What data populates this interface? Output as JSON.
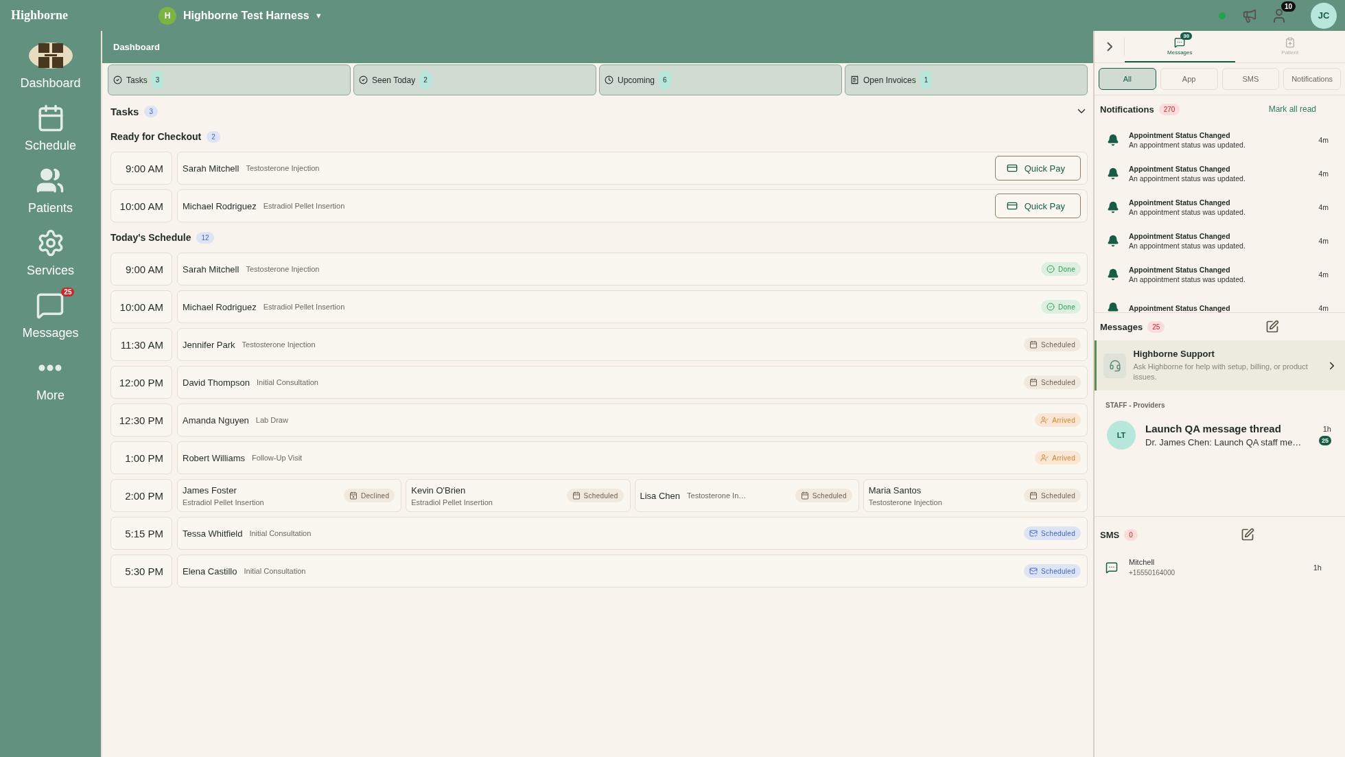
{
  "topbar": {
    "brand": "Highborne",
    "org_initial": "H",
    "org_name": "Highborne Test Harness",
    "caret": "▾",
    "people_badge": "10",
    "user_initials": "JC"
  },
  "sidebar": {
    "items": [
      {
        "label": "Dashboard"
      },
      {
        "label": "Schedule"
      },
      {
        "label": "Patients"
      },
      {
        "label": "Services"
      },
      {
        "label": "Messages",
        "badge": "25"
      },
      {
        "label": "More"
      }
    ]
  },
  "page_title": "Dashboard",
  "summary_tabs": [
    {
      "label": "Tasks",
      "count": "3"
    },
    {
      "label": "Seen Today",
      "count": "2"
    },
    {
      "label": "Upcoming",
      "count": "6"
    },
    {
      "label": "Open Invoices",
      "count": "1"
    }
  ],
  "tasks": {
    "title": "Tasks",
    "count": "3",
    "expanded": true,
    "checkout": {
      "title": "Ready for Checkout",
      "count": "2",
      "rows": [
        {
          "time": "9:00 AM",
          "name": "Sarah Mitchell",
          "service": "Testosterone Injection",
          "action": "Quick Pay"
        },
        {
          "time": "10:00 AM",
          "name": "Michael Rodriguez",
          "service": "Estradiol Pellet Insertion",
          "action": "Quick Pay"
        }
      ]
    },
    "schedule": {
      "title": "Today's Schedule",
      "count": "12",
      "rows": [
        {
          "time": "9:00 AM",
          "appointments": [
            {
              "name": "Sarah Mitchell",
              "service": "Testosterone Injection",
              "status": {
                "kind": "done",
                "label": "Done"
              }
            }
          ]
        },
        {
          "time": "10:00 AM",
          "appointments": [
            {
              "name": "Michael Rodriguez",
              "service": "Estradiol Pellet Insertion",
              "status": {
                "kind": "done",
                "label": "Done"
              }
            }
          ]
        },
        {
          "time": "11:30 AM",
          "appointments": [
            {
              "name": "Jennifer Park",
              "service": "Testosterone Injection",
              "status": {
                "kind": "scheduled",
                "label": "Scheduled"
              }
            }
          ]
        },
        {
          "time": "12:00 PM",
          "appointments": [
            {
              "name": "David Thompson",
              "service": "Initial Consultation",
              "status": {
                "kind": "scheduled",
                "label": "Scheduled"
              }
            }
          ]
        },
        {
          "time": "12:30 PM",
          "appointments": [
            {
              "name": "Amanda Nguyen",
              "service": "Lab Draw",
              "status": {
                "kind": "arrived",
                "label": "Arrived"
              }
            }
          ]
        },
        {
          "time": "1:00 PM",
          "appointments": [
            {
              "name": "Robert Williams",
              "service": "Follow-Up Visit",
              "status": {
                "kind": "arrived",
                "label": "Arrived"
              }
            }
          ]
        },
        {
          "time": "2:00 PM",
          "appointments": [
            {
              "name": "James Foster",
              "service": "Estradiol Pellet Insertion",
              "status": {
                "kind": "declined",
                "label": "Declined"
              }
            },
            {
              "name": "Kevin O'Brien",
              "service": "Estradiol Pellet Insertion",
              "status": {
                "kind": "scheduled",
                "label": "Scheduled"
              }
            },
            {
              "name": "Lisa Chen",
              "service": "Testosterone In…",
              "inline": true,
              "status": {
                "kind": "scheduled",
                "label": "Scheduled"
              }
            },
            {
              "name": "Maria Santos",
              "service": "Testosterone Injection",
              "status": {
                "kind": "scheduled",
                "label": "Scheduled"
              }
            }
          ]
        },
        {
          "time": "5:15 PM",
          "appointments": [
            {
              "name": "Tessa Whitfield",
              "service": "Initial Consultation",
              "status": {
                "kind": "confirmed",
                "label": "Scheduled"
              }
            }
          ]
        },
        {
          "time": "5:30 PM",
          "appointments": [
            {
              "name": "Elena Castillo",
              "service": "Initial Consultation",
              "status": {
                "kind": "confirmed",
                "label": "Scheduled"
              }
            }
          ]
        }
      ]
    }
  },
  "panel": {
    "tabs": [
      {
        "label": "Messages",
        "badge": "30",
        "selected": true
      },
      {
        "label": "Patient",
        "selected": false
      }
    ],
    "filters": [
      {
        "label": "All",
        "selected": true
      },
      {
        "label": "App",
        "selected": false
      },
      {
        "label": "SMS",
        "selected": false
      },
      {
        "label": "Notifications",
        "selected": false
      }
    ],
    "notifications": {
      "title": "Notifications",
      "count": "270",
      "action": "Mark all read",
      "items": [
        {
          "title": "Appointment Status Changed",
          "text": "An appointment status was updated.",
          "time": "4m"
        },
        {
          "title": "Appointment Status Changed",
          "text": "An appointment status was updated.",
          "time": "4m"
        },
        {
          "title": "Appointment Status Changed",
          "text": "An appointment status was updated.",
          "time": "4m"
        },
        {
          "title": "Appointment Status Changed",
          "text": "An appointment status was updated.",
          "time": "4m"
        },
        {
          "title": "Appointment Status Changed",
          "text": "An appointment status was updated.",
          "time": "4m"
        },
        {
          "title": "Appointment Status Changed",
          "time": "4m"
        }
      ]
    },
    "messages": {
      "title": "Messages",
      "count": "25",
      "support": {
        "title": "Highborne Support",
        "text": "Ask Highborne for help with setup, billing, or product issues."
      },
      "group": "STAFF - Providers",
      "threads": [
        {
          "initials": "LT",
          "title": "Launch QA message thread",
          "preview": "Dr. James Chen: Launch QA staff me…",
          "time": "1h",
          "unread": "25"
        }
      ]
    },
    "sms": {
      "title": "SMS",
      "count": "0",
      "items": [
        {
          "name": "Mitchell",
          "phone": "+15550164000",
          "time": "1h"
        }
      ]
    }
  }
}
